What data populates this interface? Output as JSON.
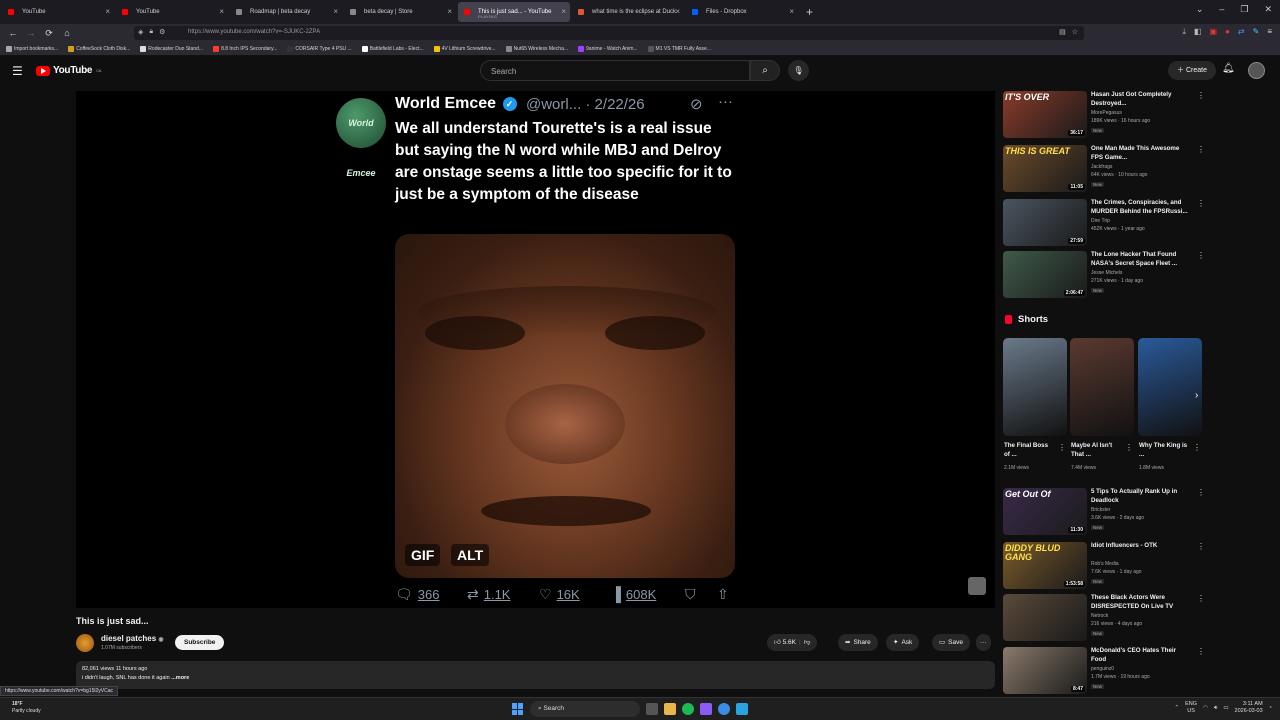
{
  "browser": {
    "tabs": [
      {
        "label": "YouTube",
        "color": "#ff0000"
      },
      {
        "label": "YouTube",
        "color": "#ff0000"
      },
      {
        "label": "Roadmap | beta decay",
        "color": "#888888"
      },
      {
        "label": "beta decay | Store",
        "color": "#888888"
      },
      {
        "label": "This is just sad... - YouTube",
        "sub": "PLAYING",
        "color": "#ff0000"
      },
      {
        "label": "what time is the eclipse at Duck",
        "color": "#de5833"
      },
      {
        "label": "Files - Dropbox",
        "color": "#0061ff"
      }
    ],
    "url": "https://www.youtube.com/watch?v=-SJUKC-2ZPA",
    "bookmarks": [
      {
        "label": "Import bookmarks...",
        "color": "#aaaaaa"
      },
      {
        "label": "CoffeeSock Cloth Disk...",
        "color": "#d4a017"
      },
      {
        "label": "Rodecaster Duo Stand...",
        "color": "#dddddd"
      },
      {
        "label": "8.8 Inch IPS Secondary...",
        "color": "#ff3b30"
      },
      {
        "label": "CORSAIR Type 4 PSU ...",
        "color": "#333333"
      },
      {
        "label": "Battlefield Labs - Elect...",
        "color": "#ffffff"
      },
      {
        "label": "4V Lithium Screwdrive...",
        "color": "#f5c400"
      },
      {
        "label": "Nut65 Wireless Mecha...",
        "color": "#888888"
      },
      {
        "label": "9anime - Watch Anim...",
        "color": "#a040ff"
      },
      {
        "label": "M1 VS TMR Fully Asse...",
        "color": "#555555"
      }
    ]
  },
  "yt": {
    "logo": "YouTube",
    "country": "CA",
    "search_placeholder": "Search",
    "create": "Create"
  },
  "tweet": {
    "avatar_text": "World Emcee",
    "name": "World Emcee",
    "handle": "@worl... · 2/22/26",
    "text": "We all understand Tourette's is a real issue but saying the N word while MBJ and Delroy are onstage seems a little too specific for it to just be a symptom of the disease",
    "gif": "GIF",
    "alt": "ALT",
    "replies": "366",
    "retweets": "1.1K",
    "likes": "16K",
    "views": "608K"
  },
  "video": {
    "title": "This is just sad...",
    "channel": "diesel patches",
    "subscribers": "1.07M subscribers",
    "subscribe": "Subscribe",
    "likes": "5.6K",
    "share": "Share",
    "ask": "Ask",
    "save": "Save",
    "meta": "82,061 views  11 hours ago",
    "description": "i didn't laugh, SNL has done it again",
    "more": "...more"
  },
  "status_url": "https://www.youtube.com/watch?v=bg15l2yVCac",
  "recommendations": [
    {
      "title": "Hasan Just Got Completely Destroyed...",
      "channel": "MorePegasus",
      "meta": "189K views · 16 hours ago",
      "badge": "New",
      "duration": "36:17",
      "thumb_text": "IT'S OVER",
      "bg": "#8a3b2a"
    },
    {
      "title": "One Man Made This Awesome FPS Game...",
      "channel": "Jackfrags",
      "meta": "64K views · 10 hours ago",
      "badge": "New",
      "duration": "11:05",
      "thumb_text": "THIS IS GREAT",
      "bg": "#6b4a2a"
    },
    {
      "title": "The Crimes, Conspiracies, and MURDER Behind the FPSRussi...",
      "channel": "Dire Trip",
      "meta": "452K views · 1 year ago",
      "badge": "",
      "duration": "27:59",
      "thumb_text": "",
      "bg": "#4a5560"
    },
    {
      "title": "The Lone Hacker That Found NASA's Secret Space Fleet ...",
      "channel": "Jesse Michels",
      "meta": "271K views · 1 day ago",
      "badge": "New",
      "duration": "2:06:47",
      "thumb_text": "",
      "bg": "#3f5a4a"
    }
  ],
  "shorts": {
    "heading": "Shorts",
    "items": [
      {
        "title": "The Final Boss of ...",
        "views": "2.1M views",
        "bg": "#6a7a8a"
      },
      {
        "title": "Maybe AI Isn't That ...",
        "views": "7.4M views",
        "bg": "#5a3a30"
      },
      {
        "title": "Why The King is ...",
        "views": "1.8M views",
        "bg": "#2a5a9a"
      }
    ]
  },
  "recommendations2": [
    {
      "title": "5 Tips To Actually Rank Up in Deadlock",
      "channel": "Brickster",
      "meta": "3.6K views · 2 days ago",
      "badge": "New",
      "duration": "11:30",
      "thumb_text": "Get Out Of",
      "bg": "#3a2a4a"
    },
    {
      "title": "Idiot Influencers - OTK",
      "channel": "Rob's Media",
      "meta": "7.6K views · 1 day ago",
      "badge": "New",
      "duration": "1:53:58",
      "thumb_text": "DIDDY BLUD GANG",
      "bg": "#7a5a2a"
    },
    {
      "title": "These Black Actors Were DISRESPECTED On Live TV",
      "channel": "Netrock",
      "meta": "216 views · 4 days ago",
      "badge": "New",
      "duration": "",
      "thumb_text": "",
      "bg": "#5a4a3a"
    },
    {
      "title": "McDonald's CEO Hates Their Food",
      "channel": "penguinz0",
      "meta": "1.7M views · 19 hours ago",
      "badge": "New",
      "duration": "8:47",
      "thumb_text": "",
      "bg": "#8a7a6a"
    }
  ],
  "taskbar": {
    "temp": "18°F",
    "weather": "Partly cloudy",
    "search": "Search",
    "lang1": "ENG",
    "lang2": "US",
    "time": "3:11 AM",
    "date": "2026-03-03"
  }
}
